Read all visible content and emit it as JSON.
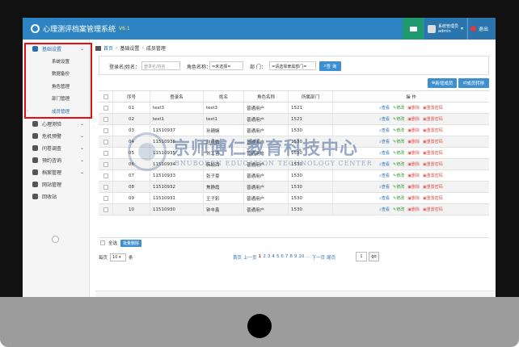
{
  "app": {
    "title": "心理测评档案管理系统",
    "version": "V6.1",
    "user_role": "系统管理员",
    "user_name": "admin",
    "logout_label": "退出"
  },
  "sidebar": {
    "groups": [
      {
        "label": "基础设置",
        "icon": "gears-icon",
        "active": true
      },
      {
        "label": "心理测验",
        "icon": "pencil-icon"
      },
      {
        "label": "危机预警",
        "icon": "warning-icon"
      },
      {
        "label": "问卷调查",
        "icon": "survey-icon"
      },
      {
        "label": "预约咨询",
        "icon": "clock-icon"
      },
      {
        "label": "档案管理",
        "icon": "archive-icon"
      },
      {
        "label": "网站管理",
        "icon": "globe-icon"
      },
      {
        "label": "回收站",
        "icon": "trash-icon"
      }
    ],
    "sub_items": [
      "系统设置",
      "数据备份",
      "角色管理",
      "部门管理",
      "成员管理"
    ]
  },
  "breadcrumb": {
    "home": "首页",
    "section": "基础设置",
    "page": "成员管理"
  },
  "search": {
    "login_label": "登录名/姓名：",
    "login_placeholder": "登录名/姓名",
    "role_label": "角色名称：",
    "role_value": "=未选择=",
    "dept_label": "部 门：",
    "dept_value": "=请选择隶属部门=",
    "query_label": "查 询"
  },
  "actions": {
    "add_label": "新增成员",
    "import_label": "成员转移"
  },
  "table": {
    "headers": [
      "序号",
      "登录名",
      "姓名",
      "角色名称",
      "所属部门",
      "操 作"
    ],
    "ops": [
      "查看",
      "修改",
      "删除",
      "重置密码"
    ],
    "rows": [
      [
        "01",
        "test3",
        "test3",
        "普通用户",
        "1521"
      ],
      [
        "02",
        "test1",
        "test1",
        "普通用户",
        "1521"
      ],
      [
        "03",
        "11510937",
        "孙珊娴",
        "普通用户",
        "1530"
      ],
      [
        "04",
        "11510936",
        "赵绮鹏",
        "普通用户",
        "1530"
      ],
      [
        "05",
        "11510935",
        "刘工宙",
        "普通用户",
        "1530"
      ],
      [
        "06",
        "11510934",
        "韩颖西",
        "普通用户",
        "1530"
      ],
      [
        "07",
        "11510933",
        "张子豪",
        "普通用户",
        "1530"
      ],
      [
        "08",
        "11510932",
        "焦静霞",
        "普通用户",
        "1530"
      ],
      [
        "09",
        "11510931",
        "王子彩",
        "普通用户",
        "1530"
      ],
      [
        "10",
        "11510930",
        "钟丰鑫",
        "普通用户",
        "1530"
      ]
    ]
  },
  "footer": {
    "select_all": "全选",
    "batch_delete": "批量删除"
  },
  "pager": {
    "per_page_label": "每页",
    "per_page_value": "10",
    "per_page_unit": "条",
    "first": "首页",
    "prev": "上一页",
    "pages": [
      "1",
      "2",
      "3",
      "4",
      "5",
      "6",
      "7",
      "8",
      "9",
      "10"
    ],
    "current": "1",
    "more": "...",
    "next": "下一页",
    "last": "尾页",
    "page_input": "1",
    "go": "go"
  },
  "watermark": {
    "cn": "京师博仁教育科技中心",
    "en": "BNUBOREN EDUCATION TECHNOLOGY CENTER"
  },
  "colors": {
    "header": "#2e84c2",
    "accent": "#3d8fd0",
    "danger": "#d9534f",
    "highlight": "#e01010"
  }
}
